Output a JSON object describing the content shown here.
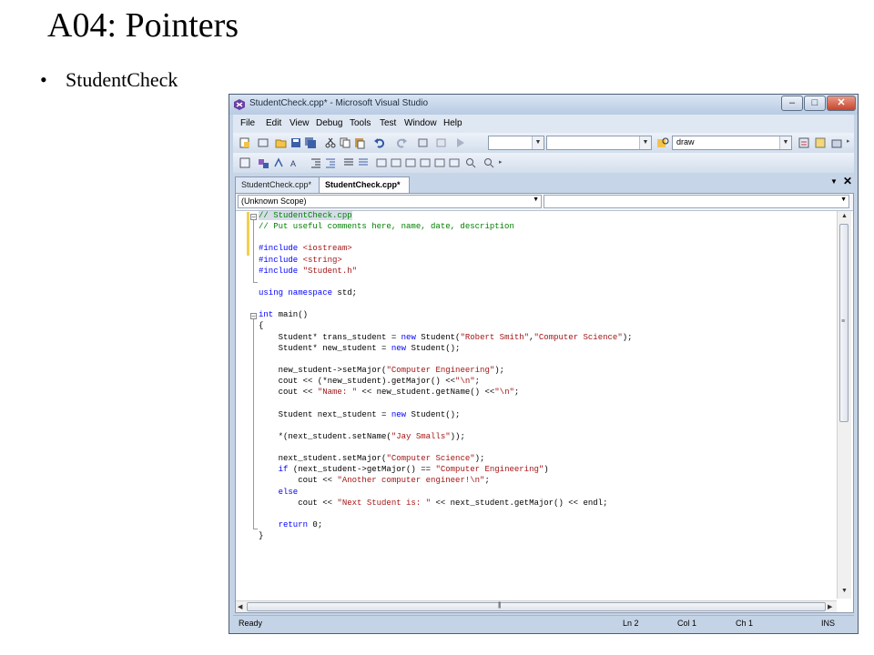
{
  "slide": {
    "title": "A04: Pointers",
    "bullet": "StudentCheck"
  },
  "window": {
    "title": "StudentCheck.cpp* - Microsoft Visual Studio",
    "controls": {
      "minimize": "–",
      "maximize": "□",
      "close": "✕"
    }
  },
  "menu": [
    "File",
    "Edit",
    "View",
    "Debug",
    "Tools",
    "Test",
    "Window",
    "Help"
  ],
  "toolbar": {
    "config_combo": "",
    "platform_combo": "",
    "find_combo": "draw"
  },
  "tabs": [
    {
      "label": "StudentCheck.cpp*",
      "active": false
    },
    {
      "label": "StudentCheck.cpp*",
      "active": true
    }
  ],
  "tab_controls": {
    "dropdown": "▼",
    "close": "✕"
  },
  "editor": {
    "scope": "(Unknown Scope)",
    "member": "",
    "lines": [
      [
        {
          "t": "// StudentCheck.cpp",
          "c": "comment highlight"
        }
      ],
      [
        {
          "t": "// Put useful comments here, name, date, description",
          "c": "comment"
        }
      ],
      [],
      [
        {
          "t": "#include ",
          "c": "keyword"
        },
        {
          "t": "<iostream>",
          "c": "string"
        }
      ],
      [
        {
          "t": "#include ",
          "c": "keyword"
        },
        {
          "t": "<string>",
          "c": "string"
        }
      ],
      [
        {
          "t": "#include ",
          "c": "keyword"
        },
        {
          "t": "\"Student.h\"",
          "c": "string"
        }
      ],
      [],
      [
        {
          "t": "using namespace ",
          "c": "keyword"
        },
        {
          "t": "std;",
          "c": ""
        }
      ],
      [],
      [
        {
          "t": "int ",
          "c": "keyword"
        },
        {
          "t": "main()",
          "c": ""
        }
      ],
      [
        {
          "t": "{",
          "c": ""
        }
      ],
      [
        {
          "t": "    Student* trans_student = ",
          "c": ""
        },
        {
          "t": "new ",
          "c": "keyword"
        },
        {
          "t": "Student(",
          "c": ""
        },
        {
          "t": "\"Robert Smith\"",
          "c": "string"
        },
        {
          "t": ",",
          "c": ""
        },
        {
          "t": "\"Computer Science\"",
          "c": "string"
        },
        {
          "t": ");",
          "c": ""
        }
      ],
      [
        {
          "t": "    Student* new_student = ",
          "c": ""
        },
        {
          "t": "new ",
          "c": "keyword"
        },
        {
          "t": "Student();",
          "c": ""
        }
      ],
      [],
      [
        {
          "t": "    new_student->setMajor(",
          "c": ""
        },
        {
          "t": "\"Computer Engineering\"",
          "c": "string"
        },
        {
          "t": ");",
          "c": ""
        }
      ],
      [
        {
          "t": "    cout << (*new_student).getMajor() <<",
          "c": ""
        },
        {
          "t": "\"\\n\"",
          "c": "string"
        },
        {
          "t": ";",
          "c": ""
        }
      ],
      [
        {
          "t": "    cout << ",
          "c": ""
        },
        {
          "t": "\"Name: \"",
          "c": "string"
        },
        {
          "t": " << new_student.getName() <<",
          "c": ""
        },
        {
          "t": "\"\\n\"",
          "c": "string"
        },
        {
          "t": ";",
          "c": ""
        }
      ],
      [],
      [
        {
          "t": "    Student next_student = ",
          "c": ""
        },
        {
          "t": "new ",
          "c": "keyword"
        },
        {
          "t": "Student();",
          "c": ""
        }
      ],
      [],
      [
        {
          "t": "    *(next_student.setName(",
          "c": ""
        },
        {
          "t": "\"Jay Smalls\"",
          "c": "string"
        },
        {
          "t": "));",
          "c": ""
        }
      ],
      [],
      [
        {
          "t": "    next_student.setMajor(",
          "c": ""
        },
        {
          "t": "\"Computer Science\"",
          "c": "string"
        },
        {
          "t": ");",
          "c": ""
        }
      ],
      [
        {
          "t": "    ",
          "c": ""
        },
        {
          "t": "if ",
          "c": "keyword"
        },
        {
          "t": "(next_student->getMajor() == ",
          "c": ""
        },
        {
          "t": "\"Computer Engineering\"",
          "c": "string"
        },
        {
          "t": ")",
          "c": ""
        }
      ],
      [
        {
          "t": "        cout << ",
          "c": ""
        },
        {
          "t": "\"Another computer engineer!\\n\"",
          "c": "string"
        },
        {
          "t": ";",
          "c": ""
        }
      ],
      [
        {
          "t": "    ",
          "c": ""
        },
        {
          "t": "else",
          "c": "keyword"
        }
      ],
      [
        {
          "t": "        cout << ",
          "c": ""
        },
        {
          "t": "\"Next Student is: \"",
          "c": "string"
        },
        {
          "t": " << next_student.getMajor() << endl;",
          "c": ""
        }
      ],
      [],
      [
        {
          "t": "    ",
          "c": ""
        },
        {
          "t": "return ",
          "c": "keyword"
        },
        {
          "t": "0;",
          "c": ""
        }
      ],
      [
        {
          "t": "}",
          "c": ""
        }
      ]
    ]
  },
  "status": {
    "message": "Ready",
    "line": "Ln 2",
    "col": "Col 1",
    "ch": "Ch 1",
    "mode": "INS"
  },
  "colors": {
    "comment": "#008000",
    "keyword": "#0000ff",
    "string": "#a31515",
    "window_frame": "#c5d3e6"
  }
}
